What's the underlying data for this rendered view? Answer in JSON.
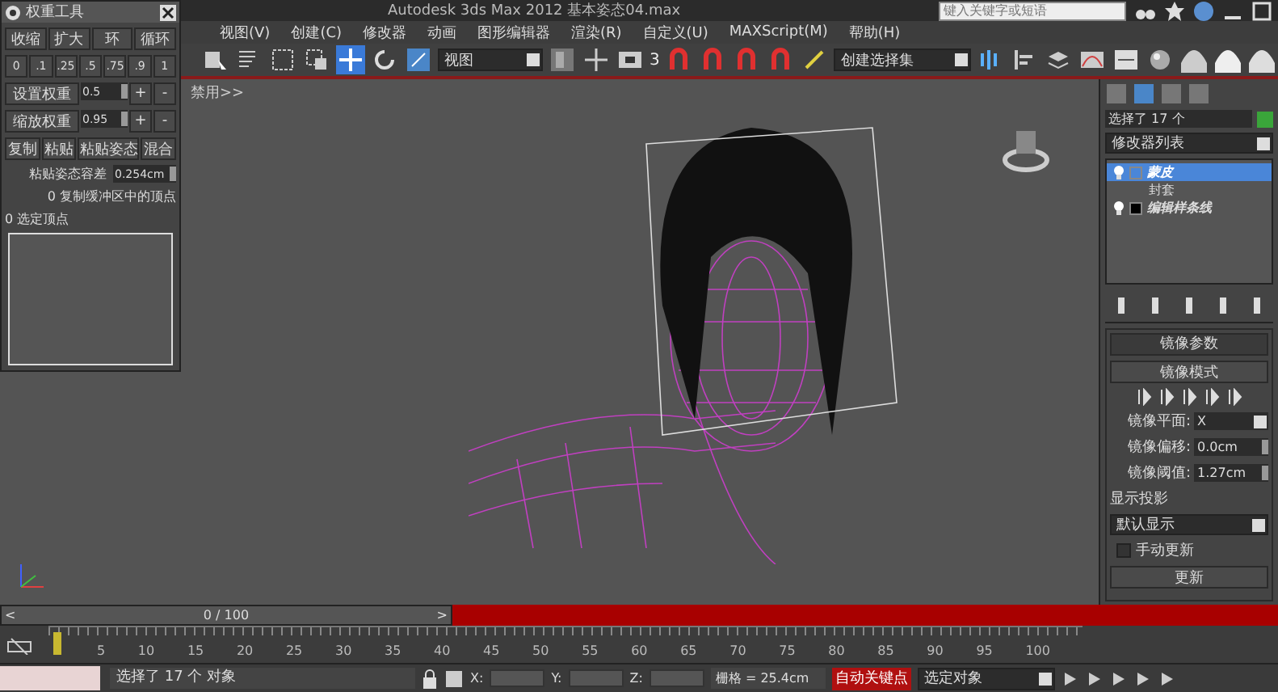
{
  "title_bar": {
    "title": "Autodesk 3ds Max  2012      基本姿态04.max",
    "search_placeholder": "键入关键字或短语"
  },
  "menu": [
    "视图(V)",
    "创建(C)",
    "修改器",
    "动画",
    "图形编辑器",
    "渲染(R)",
    "自定义(U)",
    "MAXScript(M)",
    "帮助(H)"
  ],
  "toolbar": {
    "view_dropdown": "视图",
    "snap_label": "3",
    "selection_set": "创建选择集"
  },
  "viewport": {
    "label": "禁用>>"
  },
  "weight_tool": {
    "title": "权重工具",
    "ring_buttons": [
      "收缩",
      "扩大",
      "环",
      "循环"
    ],
    "presets": [
      "0",
      ".1",
      ".25",
      ".5",
      ".75",
      ".9",
      "1"
    ],
    "weights": [
      {
        "label": "设置权重",
        "value": "0.5",
        "plus": "+",
        "minus": "-"
      },
      {
        "label": "缩放权重",
        "value": "0.95",
        "plus": "+",
        "minus": "-"
      }
    ],
    "clipboard_buttons": [
      "复制",
      "粘贴",
      "粘贴姿态",
      "混合"
    ],
    "tolerance": {
      "label": "粘贴姿态容差",
      "value": "0.254cm"
    },
    "buffer_info": "0 复制缓冲区中的顶点",
    "selected_info": "0 选定顶点"
  },
  "command_panel": {
    "selection": "选择了 17 个",
    "modifier_list": "修改器列表",
    "stack": [
      {
        "label": "蒙皮",
        "selected": true,
        "children": [
          {
            "label": "封套",
            "selected": false
          }
        ]
      },
      {
        "label": "编辑样条线",
        "selected": false
      }
    ],
    "rollout": {
      "title": "镜像参数",
      "mode_button": "镜像模式",
      "fields": [
        {
          "kind": "dropdown",
          "label": "镜像平面:",
          "value": "X"
        },
        {
          "kind": "spinner",
          "label": "镜像偏移:",
          "value": "0.0cm"
        },
        {
          "kind": "spinner",
          "label": "镜像阈值:",
          "value": "1.27cm"
        }
      ],
      "display_label": "显示投影",
      "display_value": "默认显示",
      "manual_update": {
        "label": "手动更新",
        "checked": false
      },
      "update_button": "更新"
    }
  },
  "timeline": {
    "level": 0,
    "frame": "0 / 100",
    "prev": "<",
    "next": ">",
    "ticks": [
      "5",
      "10",
      "15",
      "20",
      "25",
      "30",
      "35",
      "40",
      "45",
      "50",
      "55",
      "60",
      "65",
      "70",
      "75",
      "80",
      "85",
      "90",
      "95",
      "100"
    ]
  },
  "status_bar": {
    "message": "选择了 17 个 对象",
    "coords": [
      "X:",
      "Y:",
      "Z:"
    ],
    "grid": "栅格 = 25.4cm",
    "auto_key": "自动关键点",
    "key_filter": "选定对象"
  }
}
